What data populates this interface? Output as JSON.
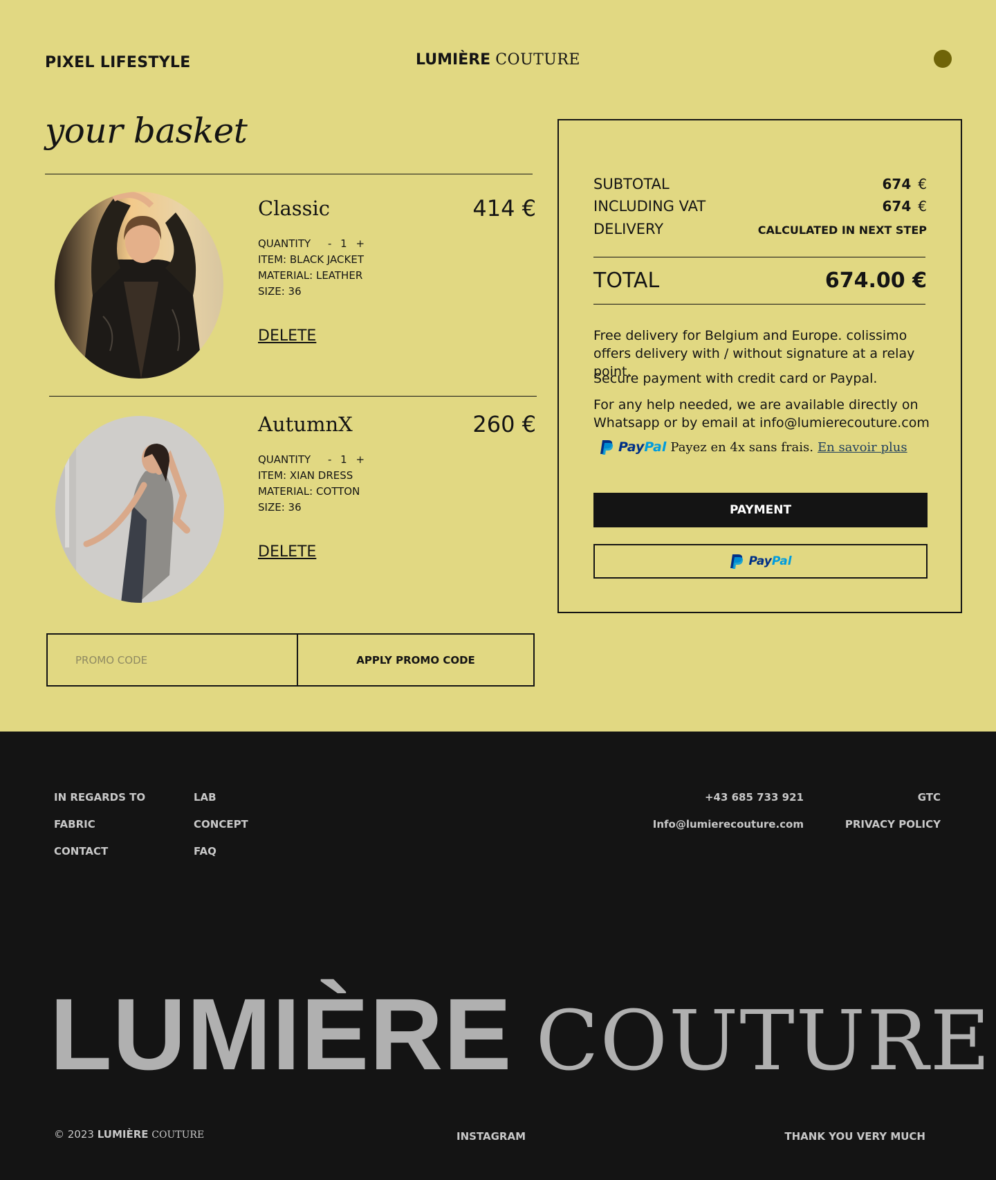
{
  "header": {
    "brand_left": "PIXEL LIFESTYLE",
    "logo_bold": "LUMIÈRE",
    "logo_serif": "COUTURE"
  },
  "basket": {
    "title": "your basket",
    "items": [
      {
        "name": "Classic",
        "price": "414 €",
        "quantity_label": "QUANTITY",
        "minus": "-",
        "quantity": "1",
        "plus": "+",
        "item": "ITEM: BLACK JACKET",
        "material": "MATERIAL: LEATHER",
        "size": "SIZE: 36",
        "delete_label": "DELETE"
      },
      {
        "name": "AutumnX",
        "price": "260 €",
        "quantity_label": "QUANTITY",
        "minus": "-",
        "quantity": "1",
        "plus": "+",
        "item": "ITEM: XIAN DRESS",
        "material": "MATERIAL: COTTON",
        "size": "SIZE: 36",
        "delete_label": "DELETE"
      }
    ]
  },
  "promo": {
    "placeholder": "PROMO CODE",
    "apply_label": "APPLY PROMO CODE"
  },
  "summary": {
    "subtotal_label": "SUBTOTAL",
    "subtotal_value": "674",
    "vat_label": "INCLUDING VAT",
    "vat_value": "674",
    "currency": "€",
    "delivery_label": "DELIVERY",
    "delivery_value": "CALCULATED IN NEXT STEP",
    "total_label": "TOTAL",
    "total_value": "674.00 €",
    "info_delivery": "Free delivery for Belgium and Europe. colissimo offers delivery with / without signature at a relay point.",
    "info_payment": "Secure payment with credit card or Paypal.",
    "info_help": "For any help needed, we are available directly on Whatsapp or by email at info@lumierecouture.com",
    "paypal_pay": "Pay",
    "paypal_pal": "Pal",
    "paypal_message": "Payez en 4x sans frais.",
    "paypal_link": "En savoir plus",
    "payment_label": "PAYMENT"
  },
  "footer": {
    "col1": [
      "IN  REGARDS TO",
      "FABRIC",
      "CONTACT"
    ],
    "col2": [
      "LAB",
      "CONCEPT",
      "FAQ"
    ],
    "phone": "+43 685 733 921",
    "email": "Info@lumierecouture.com",
    "gtc": "GTC",
    "privacy": "PRIVACY POLICY",
    "big_logo_bold": "LUMIÈRE",
    "big_logo_serif": "COUTURE",
    "copyright_prefix": "© 2023",
    "copyright_bold": "LUMIÈRE",
    "copyright_serif": "COUTURE",
    "instagram": "INSTAGRAM",
    "thanks": "THANK YOU VERY MUCH"
  },
  "colors": {
    "background": "#e1d882",
    "footer": "#141414",
    "accent_dot": "#6f6408"
  }
}
